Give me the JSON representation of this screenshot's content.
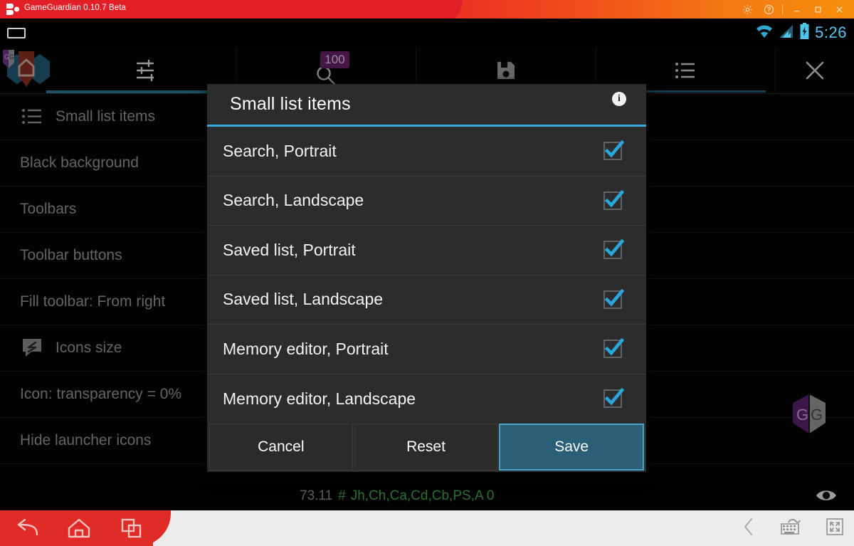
{
  "window": {
    "app_title": "GameGuardian 0.10.7 Beta",
    "controls": [
      {
        "name": "settings",
        "glyph": "⚙"
      },
      {
        "name": "help",
        "glyph": "?"
      },
      {
        "name": "minimize",
        "glyph": "—"
      },
      {
        "name": "maximize",
        "glyph": "□"
      },
      {
        "name": "close",
        "glyph": "✕"
      }
    ],
    "accent_red": "#e21f26",
    "accent_orange": "#f68f0b"
  },
  "status_bar": {
    "clock": "5:26",
    "icons": [
      "wifi-icon",
      "signal-icon",
      "battery-charging-icon"
    ],
    "accent": "#58c6ef"
  },
  "app_toolbar": {
    "items": [
      {
        "name": "gg-home-overlay-icon",
        "label": ""
      },
      {
        "name": "tune-icon",
        "label": ""
      },
      {
        "name": "search-icon",
        "label": "",
        "badge": "100"
      },
      {
        "name": "save-icon",
        "label": ""
      },
      {
        "name": "list-icon",
        "label": ""
      },
      {
        "name": "close-icon",
        "label": ""
      }
    ],
    "badge_value": "100",
    "badge_color": "#69246e",
    "tab_indicator_color": "#2a7fa3"
  },
  "settings_list": {
    "rows": [
      {
        "label": "Small list items",
        "icon": "list-icon",
        "has_icon": true
      },
      {
        "label": "Black background",
        "icon": "",
        "has_icon": false
      },
      {
        "label": "Toolbars",
        "icon": "",
        "has_icon": false
      },
      {
        "label": "Toolbar buttons",
        "icon": "",
        "has_icon": false
      },
      {
        "label": "Fill toolbar: From right",
        "icon": "",
        "has_icon": false
      },
      {
        "label": "Icons size",
        "icon": "resize-icon",
        "has_icon": true
      },
      {
        "label": "Icon: transparency = 0%",
        "icon": "",
        "has_icon": false
      },
      {
        "label": "Hide launcher icons",
        "icon": "",
        "has_icon": false
      }
    ]
  },
  "dialog": {
    "title": "Small list items",
    "info_glyph": "i",
    "accent": "#37a6d8",
    "rows": [
      {
        "label": "Search, Portrait",
        "checked": true
      },
      {
        "label": "Search, Landscape",
        "checked": true
      },
      {
        "label": "Saved list, Portrait",
        "checked": true
      },
      {
        "label": "Saved list, Landscape",
        "checked": true
      },
      {
        "label": "Memory editor, Portrait",
        "checked": true
      },
      {
        "label": "Memory editor, Landscape",
        "checked": true
      }
    ],
    "buttons": {
      "cancel": "Cancel",
      "reset": "Reset",
      "save": "Save"
    }
  },
  "bottom_status": {
    "value": "73.11",
    "hash": "#",
    "flags": "Jh,Ch,Ca,Cd,Cb,PS,A 0",
    "flag_color": "#3fae4a",
    "eye_icon": "eye-icon"
  },
  "nav_bar": {
    "buttons": [
      "back-icon",
      "home-icon",
      "recents-icon"
    ],
    "right_buttons": [
      "chevron-left-icon",
      "keyboard-icon",
      "fullscreen-icon"
    ],
    "bar_color": "#e02b27"
  }
}
